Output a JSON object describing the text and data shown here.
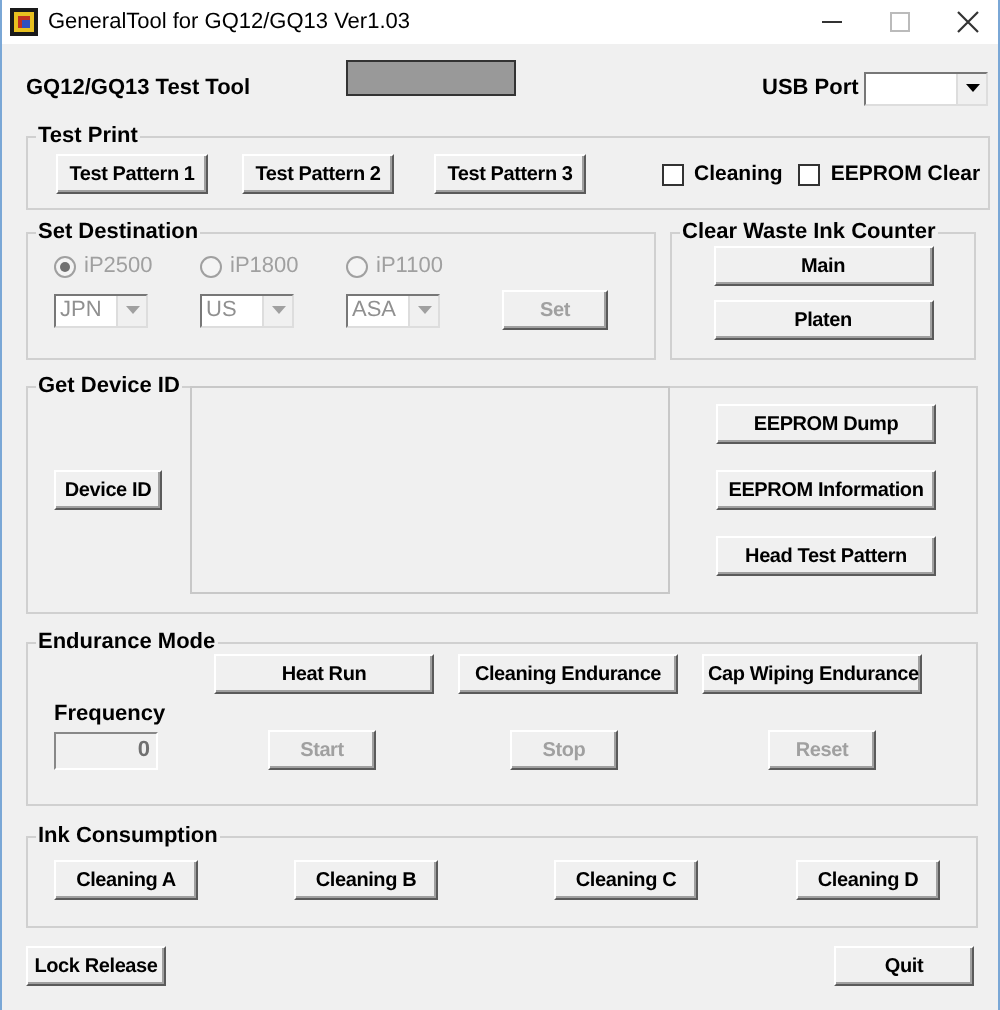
{
  "window": {
    "title": "GeneralTool for GQ12/GQ13 Ver1.03"
  },
  "header": {
    "title": "GQ12/GQ13 Test Tool",
    "usb_label": "USB Port"
  },
  "test_print": {
    "title": "Test Print",
    "buttons": [
      "Test Pattern 1",
      "Test Pattern 2",
      "Test Pattern 3"
    ],
    "checkboxes": [
      {
        "label": "Cleaning",
        "checked": false
      },
      {
        "label": "EEPROM Clear",
        "checked": false
      }
    ]
  },
  "set_destination": {
    "title": "Set Destination",
    "disabled": true,
    "radios": [
      {
        "label": "iP2500",
        "selected": true
      },
      {
        "label": "iP1800",
        "selected": false
      },
      {
        "label": "iP1100",
        "selected": false
      }
    ],
    "combos": [
      "JPN",
      "US",
      "ASA"
    ],
    "set_button": "Set"
  },
  "clear_waste": {
    "title": "Clear Waste Ink Counter",
    "buttons": [
      "Main",
      "Platen"
    ]
  },
  "device_id": {
    "title": "Get Device ID",
    "button": "Device ID",
    "buttons": [
      "EEPROM Dump",
      "EEPROM Information",
      "Head Test Pattern"
    ]
  },
  "endurance": {
    "title": "Endurance Mode",
    "modes": [
      "Heat Run",
      "Cleaning Endurance",
      "Cap Wiping Endurance"
    ],
    "frequency_label": "Frequency",
    "frequency_value": "0",
    "controls": [
      {
        "label": "Start",
        "disabled": true
      },
      {
        "label": "Stop",
        "disabled": true
      },
      {
        "label": "Reset",
        "disabled": true
      }
    ]
  },
  "ink_consumption": {
    "title": "Ink Consumption",
    "buttons": [
      "Cleaning A",
      "Cleaning B",
      "Cleaning C",
      "Cleaning D"
    ]
  },
  "footer": {
    "left_button": "Lock Release",
    "right_button": "Quit"
  }
}
